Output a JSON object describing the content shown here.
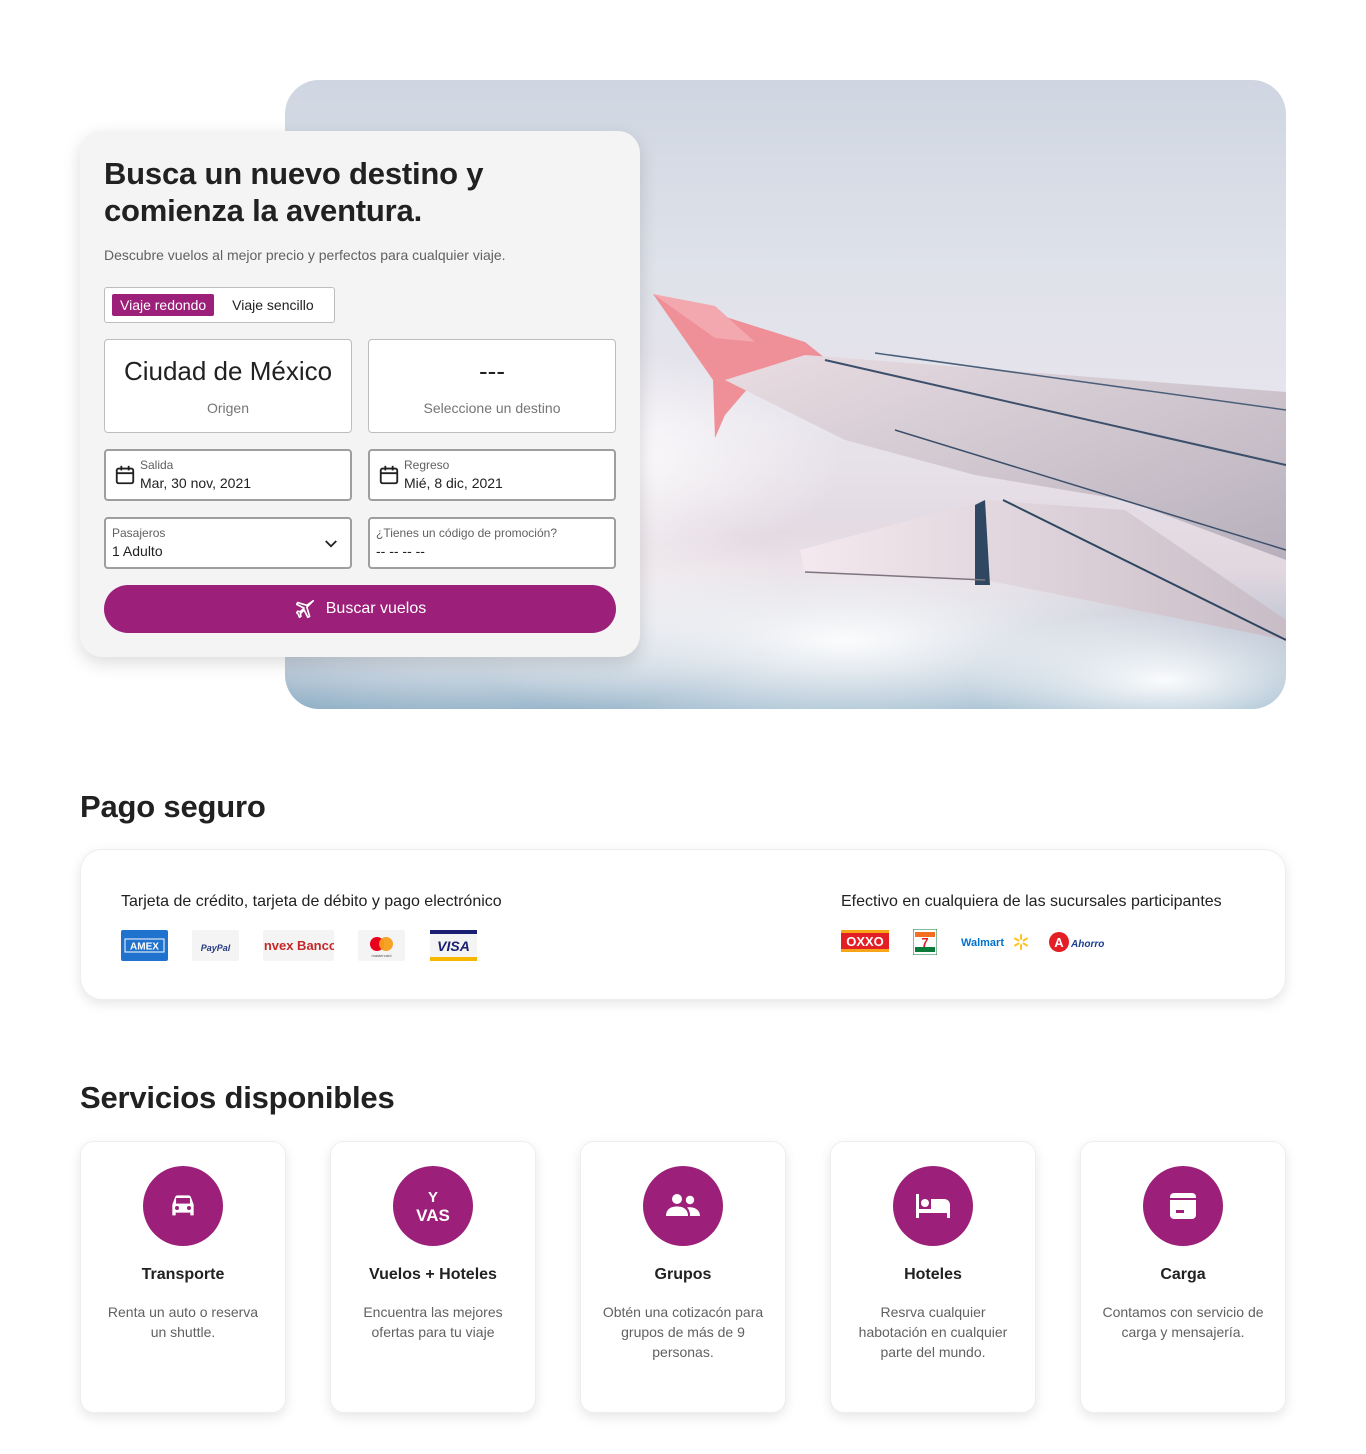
{
  "hero": {
    "title": "Busca un nuevo destino y comienza la aventura.",
    "subtitle": "Descubre vuelos al mejor precio y perfectos para cualquier viaje.",
    "trip_types": [
      "Viaje redondo",
      "Viaje sencillo"
    ],
    "active_trip_type": "Viaje redondo",
    "origin": {
      "value": "Ciudad de México",
      "label": "Origen"
    },
    "destination": {
      "value": "---",
      "label": "Seleccione un destino"
    },
    "departure": {
      "label": "Salida",
      "value": "Mar, 30 nov, 2021",
      "icon": "calendar-icon"
    },
    "return": {
      "label": "Regreso",
      "value": "Mié, 8 dic, 2021",
      "icon": "calendar-icon"
    },
    "passengers": {
      "label": "Pasajeros",
      "value": "1 Adulto",
      "icon": "chevron-down-icon"
    },
    "promo": {
      "label": "¿Tienes un código de promoción?",
      "placeholder": "-- -- -- --"
    },
    "search_button": {
      "label": "Buscar vuelos",
      "icon": "airplane-icon"
    }
  },
  "payments": {
    "title": "Pago seguro",
    "card_section_label": "Tarjeta de crédito, tarjeta de débito y pago electrónico",
    "card_logos": [
      "AMEX",
      "PayPal",
      "invex Banco",
      "mastercard",
      "VISA"
    ],
    "cash_section_label": "Efectivo en cualquiera de las sucursales participantes",
    "cash_logos": [
      "OXXO",
      "7-Eleven",
      "Walmart",
      "Farmacias del Ahorro"
    ]
  },
  "services": {
    "title": "Servicios disponibles",
    "items": [
      {
        "title": "Transporte",
        "description": "Renta un auto o reserva un shuttle.",
        "icon": "car-icon"
      },
      {
        "title": "Vuelos + Hoteles",
        "description": "Encuentra las mejores ofertas para tu viaje",
        "icon": "y-vas-logo-icon"
      },
      {
        "title": "Grupos",
        "description": "Obtén una cotizacón para grupos de más de 9 personas.",
        "icon": "group-icon"
      },
      {
        "title": "Hoteles",
        "description": "Resrva cualquier habotación en cualquier parte del mundo.",
        "icon": "bed-icon"
      },
      {
        "title": "Carga",
        "description": "Contamos con servicio de carga y mensajería.",
        "icon": "box-icon"
      }
    ]
  },
  "colors": {
    "brand": "#9c2079",
    "text": "#212121",
    "muted": "#616161"
  }
}
